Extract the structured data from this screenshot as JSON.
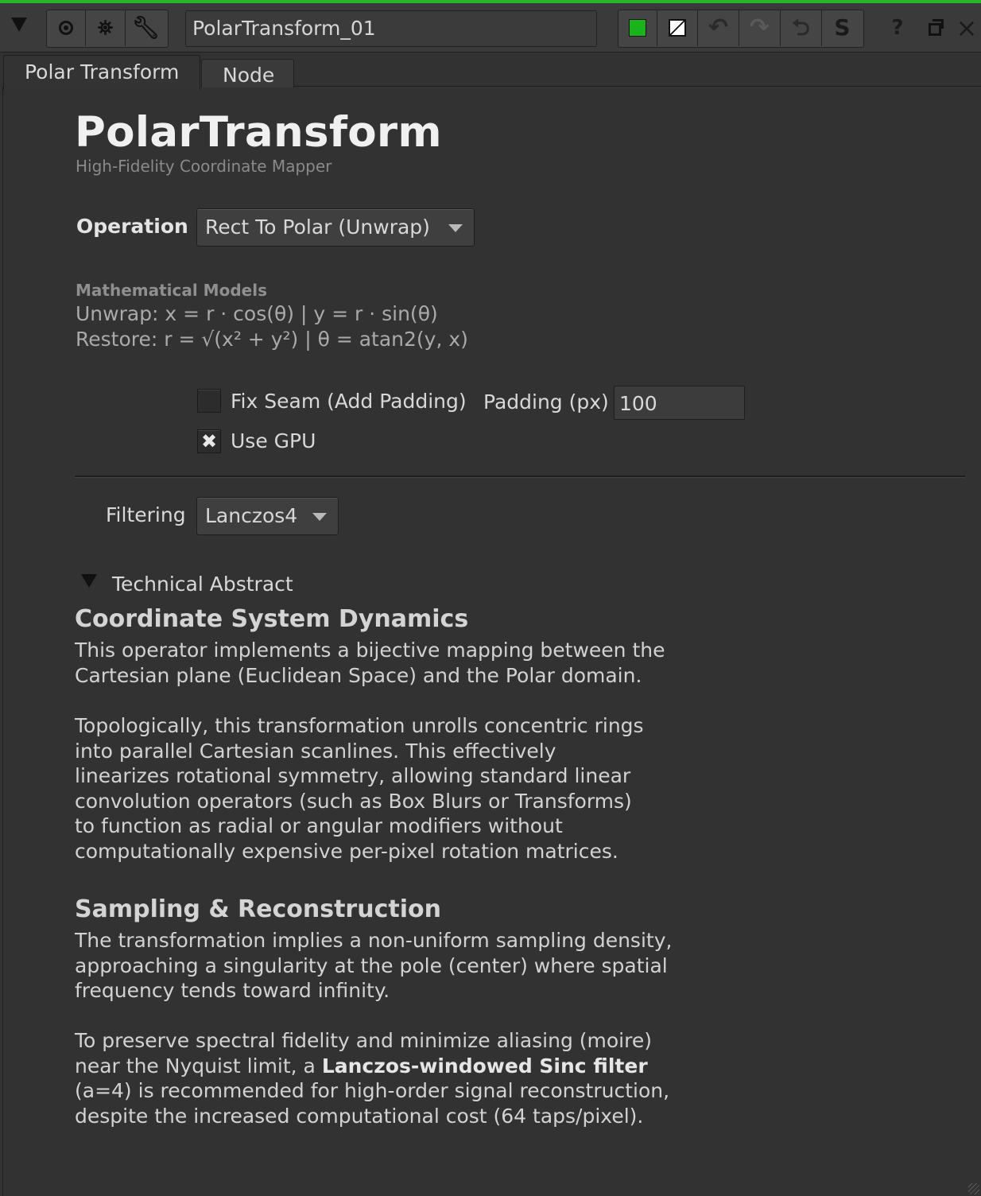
{
  "toolbar": {
    "collapse_icon": "triangle-down",
    "node_name": "PolarTransform_01",
    "buttons": {
      "center": "target-icon",
      "bug": "bug-icon",
      "wrench": "wrench-icon",
      "color": "green-square-icon",
      "mask": "diagonal-square-icon",
      "undo": "undo-icon",
      "redo": "redo-icon",
      "revert": "revert-icon",
      "script": "S",
      "help": "?",
      "float": "float-window-icon",
      "close": "×"
    }
  },
  "tabs": [
    {
      "label": "Polar Transform",
      "active": true
    },
    {
      "label": "Node",
      "active": false
    }
  ],
  "header": {
    "title": "PolarTransform",
    "subtitle": "High-Fidelity Coordinate Mapper"
  },
  "operation": {
    "label": "Operation",
    "value": "Rect To Polar (Unwrap)"
  },
  "math": {
    "heading": "Mathematical Models",
    "unwrap": "Unwrap: x = r · cos(θ)  |  y = r · sin(θ)",
    "restore": "Restore: r = √(x² + y²)  |  θ = atan2(y, x)"
  },
  "options": {
    "fix_seam_label": "Fix Seam (Add Padding)",
    "fix_seam_checked": false,
    "padding_label": "Padding (px)",
    "padding_value": "100",
    "use_gpu_label": "Use GPU",
    "use_gpu_checked": true,
    "use_gpu_mark": "✖"
  },
  "filtering": {
    "label": "Filtering",
    "value": "Lanczos4"
  },
  "abstract": {
    "toggle_label": "Technical Abstract",
    "section1_title": "Coordinate System Dynamics",
    "section1_p1": "This operator implements a bijective mapping between the Cartesian plane (Euclidean Space) and the Polar domain.",
    "section1_p2": "Topologically, this transformation unrolls concentric rings into parallel Cartesian scanlines. This effectively linearizes rotational symmetry, allowing standard linear convolution operators (such as Box Blurs or Transforms) to function as radial or angular modifiers without computationally expensive per-pixel rotation matrices.",
    "section2_title": "Sampling & Reconstruction",
    "section2_p1": "The transformation implies a non-uniform sampling density, approaching a singularity at the pole (center) where spatial frequency tends toward infinity.",
    "section2_p2_before": "To preserve spectral fidelity and minimize aliasing (moire) near the Nyquist limit, a ",
    "section2_p2_bold": "Lanczos-windowed Sinc filter",
    "section2_p2_after": " (a=4) is recommended for high-order signal reconstruction, despite the increased computational cost (64 taps/pixel)."
  },
  "colors": {
    "accent_green": "#26b52a",
    "panel_bg": "#323232"
  }
}
